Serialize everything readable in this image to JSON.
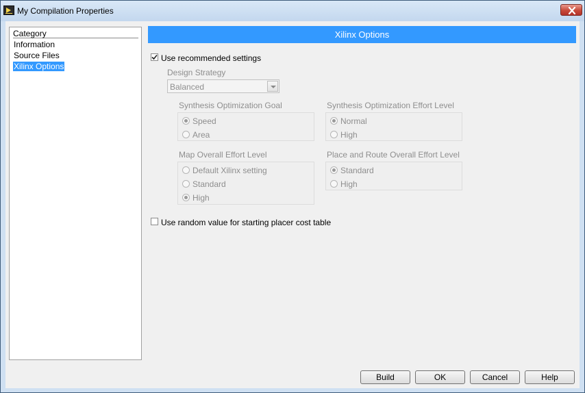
{
  "window": {
    "title": "My Compilation Properties",
    "app_icon": "labview-app-icon",
    "close_icon": "close-icon"
  },
  "category": {
    "header": "Category",
    "items": [
      {
        "label": "Information",
        "selected": false
      },
      {
        "label": "Source Files",
        "selected": false
      },
      {
        "label": "Xilinx Options",
        "selected": true
      }
    ]
  },
  "panel": {
    "title": "Xilinx Options",
    "use_recommended": {
      "label": "Use recommended settings",
      "checked": true
    },
    "design_strategy": {
      "label": "Design Strategy",
      "value": "Balanced"
    },
    "synth_goal": {
      "label": "Synthesis Optimization Goal",
      "options": [
        "Speed",
        "Area"
      ],
      "selected": "Speed"
    },
    "synth_effort": {
      "label": "Synthesis Optimization Effort Level",
      "options": [
        "Normal",
        "High"
      ],
      "selected": "Normal"
    },
    "map_effort": {
      "label": "Map Overall Effort Level",
      "options": [
        "Default Xilinx setting",
        "Standard",
        "High"
      ],
      "selected": "High"
    },
    "par_effort": {
      "label": "Place and Route Overall Effort Level",
      "options": [
        "Standard",
        "High"
      ],
      "selected": "Standard"
    },
    "random_placer": {
      "label": "Use random value for starting placer cost table",
      "checked": false
    }
  },
  "buttons": {
    "build": "Build",
    "ok": "OK",
    "cancel": "Cancel",
    "help": "Help"
  },
  "colors": {
    "accent": "#3399ff",
    "titlebar": "#c3d7ee",
    "close": "#c84a3a"
  }
}
